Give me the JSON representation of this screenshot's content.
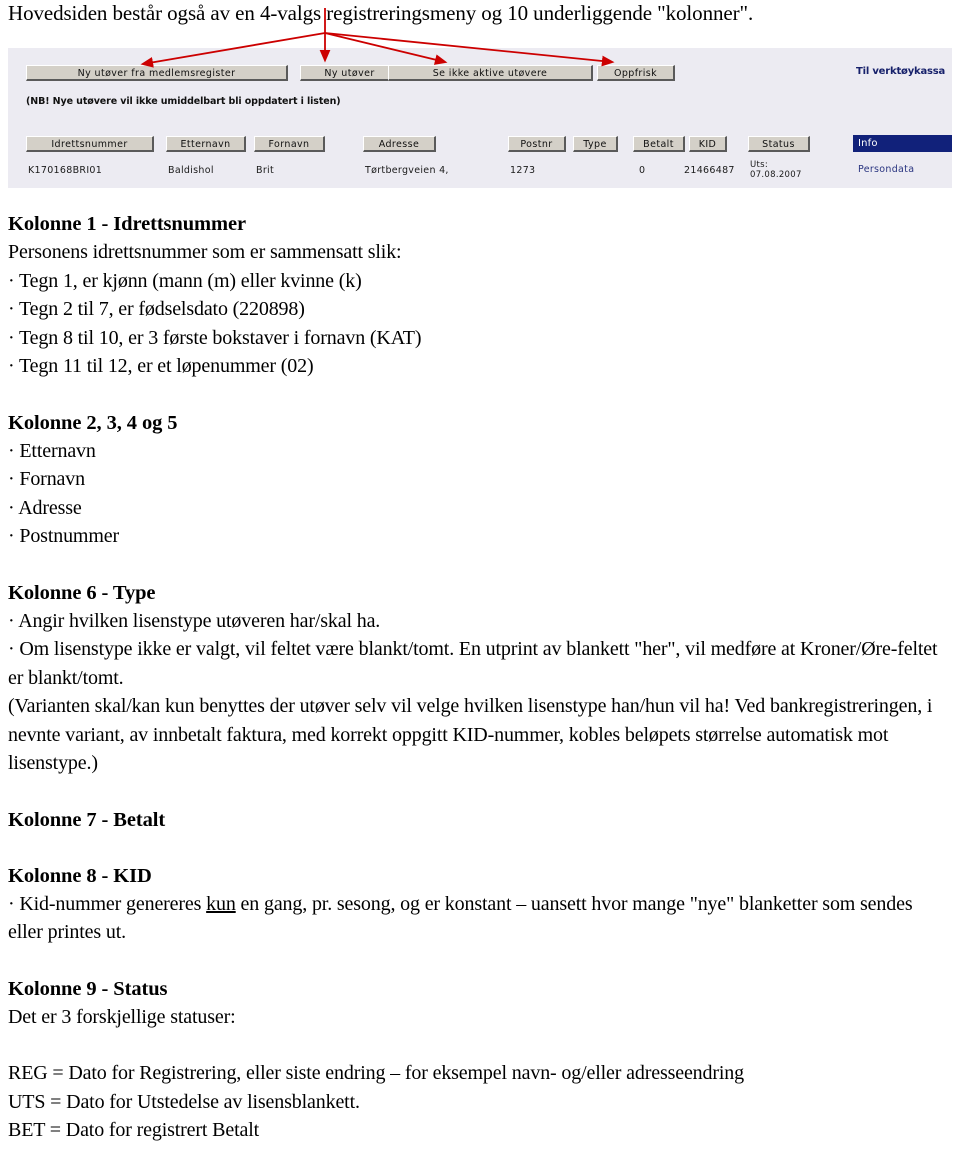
{
  "intro": {
    "line": "Hovedsiden består også av en 4-valgs registreringsmeny og 10 underliggende \"kolonner\"."
  },
  "app_screenshot": {
    "action_buttons": [
      {
        "label": "Ny utøver fra medlemsregister"
      },
      {
        "label": "Ny utøver"
      },
      {
        "label": "Se ikke aktive utøvere"
      },
      {
        "label": "Oppfrisk"
      }
    ],
    "note": "(NB! Nye utøvere vil ikke umiddelbart bli oppdatert i listen)",
    "toolbox_link": "Til verktøykassa",
    "info_header": "Info",
    "info_value": "Persondata",
    "column_headers": [
      "Idrettsnummer",
      "Etternavn",
      "Fornavn",
      "Adresse",
      "Postnr",
      "Type",
      "Betalt",
      "KID",
      "Status"
    ],
    "row": {
      "idrettsnummer": "K170168BRI01",
      "etternavn": "Baldishol",
      "fornavn": "Brit",
      "adresse": "Tørtbergveien 4,",
      "postnr": "1273",
      "type": "",
      "betalt": "0",
      "kid": "21466487",
      "status_label": "Uts:",
      "status_date": "07.08.2007"
    },
    "colors": {
      "panel_bg": "#ecebf2",
      "button_face": "#d4d0c8",
      "info_bg": "#11217a",
      "link_navy": "#17216b",
      "arrow_red": "#cc0000"
    }
  },
  "sections": {
    "kolonne1": {
      "heading": "Kolonne 1 - Idrettsnummer",
      "intro": "Personens idrettsnummer som er sammensatt slik:",
      "bullets": [
        "· Tegn 1, er kjønn (mann (m) eller kvinne (k)",
        "· Tegn 2 til 7, er fødselsdato (220898)",
        "· Tegn 8 til 10, er 3 første bokstaver i fornavn (KAT)",
        "· Tegn 11 til 12, er et løpenummer (02)"
      ]
    },
    "kolonne2345": {
      "heading": "Kolonne 2, 3, 4 og 5",
      "bullets": [
        "· Etternavn",
        "· Fornavn",
        "· Adresse",
        "· Postnummer"
      ]
    },
    "kolonne6": {
      "heading": "Kolonne 6 - Type",
      "lines": [
        "· Angir hvilken lisenstype utøveren har/skal ha.",
        "· Om lisenstype ikke er valgt, vil feltet være blankt/tomt. En utprint av blankett \"her\", vil medføre at Kroner/Øre-feltet er blankt/tomt.",
        "(Varianten skal/kan kun benyttes der utøver selv vil velge hvilken lisenstype han/hun vil ha! Ved bankregistreringen, i nevnte variant, av innbetalt faktura, med korrekt oppgitt KID-nummer, kobles beløpets størrelse automatisk mot lisenstype.)"
      ]
    },
    "kolonne7": {
      "heading": "Kolonne 7 - Betalt"
    },
    "kolonne8": {
      "heading": "Kolonne 8 - KID",
      "text_before": "· Kid-nummer genereres ",
      "underlined": "kun",
      "text_after": " en gang, pr. sesong, og er konstant – uansett hvor mange \"nye\" blanketter som sendes eller printes ut."
    },
    "kolonne9": {
      "heading": "Kolonne 9 - Status",
      "intro": "Det er 3 forskjellige statuser:",
      "statuses": [
        "REG = Dato for Registrering, eller siste endring – for eksempel navn- og/eller adresseendring",
        "UTS = Dato for Utstedelse av lisensblankett.",
        "BET = Dato for registrert Betalt"
      ]
    }
  }
}
